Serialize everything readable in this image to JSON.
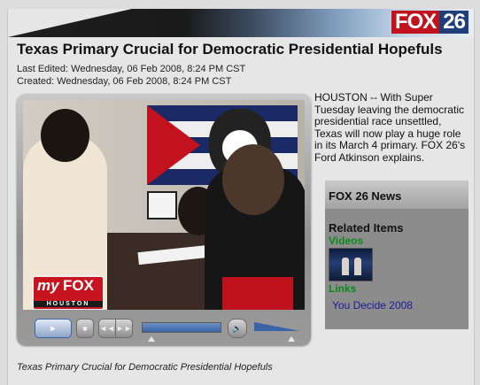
{
  "header": {
    "logo_text": "FOX",
    "logo_number": "26"
  },
  "article": {
    "headline": "Texas Primary Crucial for Democratic Presidential Hopefuls",
    "last_edited": "Last Edited: Wednesday, 06 Feb 2008, 8:24 PM CST",
    "created": "Created: Wednesday, 06 Feb 2008, 8:24 PM CST",
    "intro": "HOUSTON  --  With Super Tuesday leaving the democratic presidential race unsettled, Texas will now play a huge role in its March 4 primary. FOX 26's Ford Atkinson explains.",
    "caption": "Texas Primary Crucial for Democratic Presidential Hopefuls"
  },
  "player": {
    "badge_my": "my",
    "badge_fox": "FOX",
    "badge_city": "HOUSTON",
    "play_icon": "play-icon",
    "stop_icon": "stop-icon",
    "rewind_icon": "rewind-icon",
    "forward_icon": "fast-forward-icon",
    "volume_icon": "speaker-icon",
    "play_glyph": "►",
    "stop_glyph": "■",
    "rewind_glyph": "◄◄",
    "forward_glyph": "►►",
    "volume_glyph": "🔊"
  },
  "sidebar": {
    "box_title": "FOX 26 News",
    "related_title": "Related Items",
    "videos_label": "Videos",
    "links_label": "Links",
    "links": [
      "You Decide 2008"
    ]
  },
  "colors": {
    "brand_red": "#c2121e",
    "brand_blue": "#1e3f7a",
    "section_green": "#0a8a1a",
    "link_blue": "#1a1a9a"
  }
}
